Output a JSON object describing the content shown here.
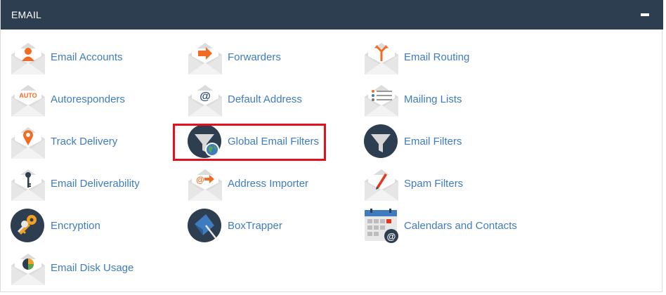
{
  "section": {
    "title": "EMAIL",
    "collapse_icon": "minus-icon"
  },
  "colors": {
    "header_bg": "#2d3e50",
    "link": "#3f7cbf",
    "accent": "#f26b21",
    "highlight": "#e3111e"
  },
  "items": [
    {
      "label": "Email Accounts",
      "icon": "envelope-person-icon"
    },
    {
      "label": "Forwarders",
      "icon": "envelope-arrow-icon"
    },
    {
      "label": "Email Routing",
      "icon": "envelope-routing-icon"
    },
    {
      "label": "Autoresponders",
      "icon": "envelope-auto-icon"
    },
    {
      "label": "Default Address",
      "icon": "envelope-at-icon"
    },
    {
      "label": "Mailing Lists",
      "icon": "envelope-list-icon"
    },
    {
      "label": "Track Delivery",
      "icon": "envelope-location-pin-icon"
    },
    {
      "label": "Global Email Filters",
      "icon": "funnel-globe-icon"
    },
    {
      "label": "Email Filters",
      "icon": "funnel-icon"
    },
    {
      "label": "Email Deliverability",
      "icon": "envelope-key-icon"
    },
    {
      "label": "Address Importer",
      "icon": "envelope-at-arrow-icon"
    },
    {
      "label": "Spam Filters",
      "icon": "envelope-pen-icon"
    },
    {
      "label": "Encryption",
      "icon": "keys-icon"
    },
    {
      "label": "BoxTrapper",
      "icon": "boxtrapper-icon"
    },
    {
      "label": "Calendars and Contacts",
      "icon": "calendar-at-icon"
    },
    {
      "label": "Email Disk Usage",
      "icon": "envelope-pie-chart-icon"
    }
  ]
}
